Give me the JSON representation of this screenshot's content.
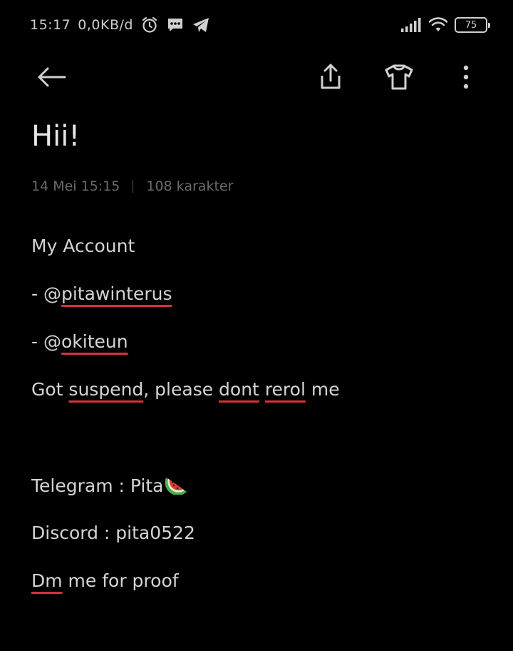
{
  "status": {
    "time": "15:17",
    "net_speed": "0,0KB/d",
    "battery": "75"
  },
  "icons": {
    "alarm": "alarm-clock-icon",
    "message": "message-icon",
    "telegram": "telegram-icon",
    "signal": "signal-icon",
    "wifi": "wifi-icon",
    "back": "back-arrow-icon",
    "share": "share-icon",
    "theme": "shirt-icon",
    "more": "more-vert-icon"
  },
  "note": {
    "title": "Hii!",
    "date": "14 Mei  15:15",
    "char_count": "108 karakter",
    "lines": {
      "l1": "My Account",
      "l2_prefix": "- @",
      "l2_handle": "pitawinterus",
      "l3_prefix": "- @",
      "l3_handle": "okiteun",
      "l4_a": "Got ",
      "l4_b": "suspend",
      "l4_c": ", please ",
      "l4_d": "dont",
      "l4_e": " ",
      "l4_f": "rerol",
      "l4_g": " me",
      "l5": "Telegram : Pita",
      "l6": "Discord : pita0522",
      "l7_a": "Dm",
      "l7_b": " me for proof"
    }
  },
  "colors": {
    "background": "#000000",
    "spell_underline": "#d6323a",
    "meta_text": "#6a6a6a"
  }
}
